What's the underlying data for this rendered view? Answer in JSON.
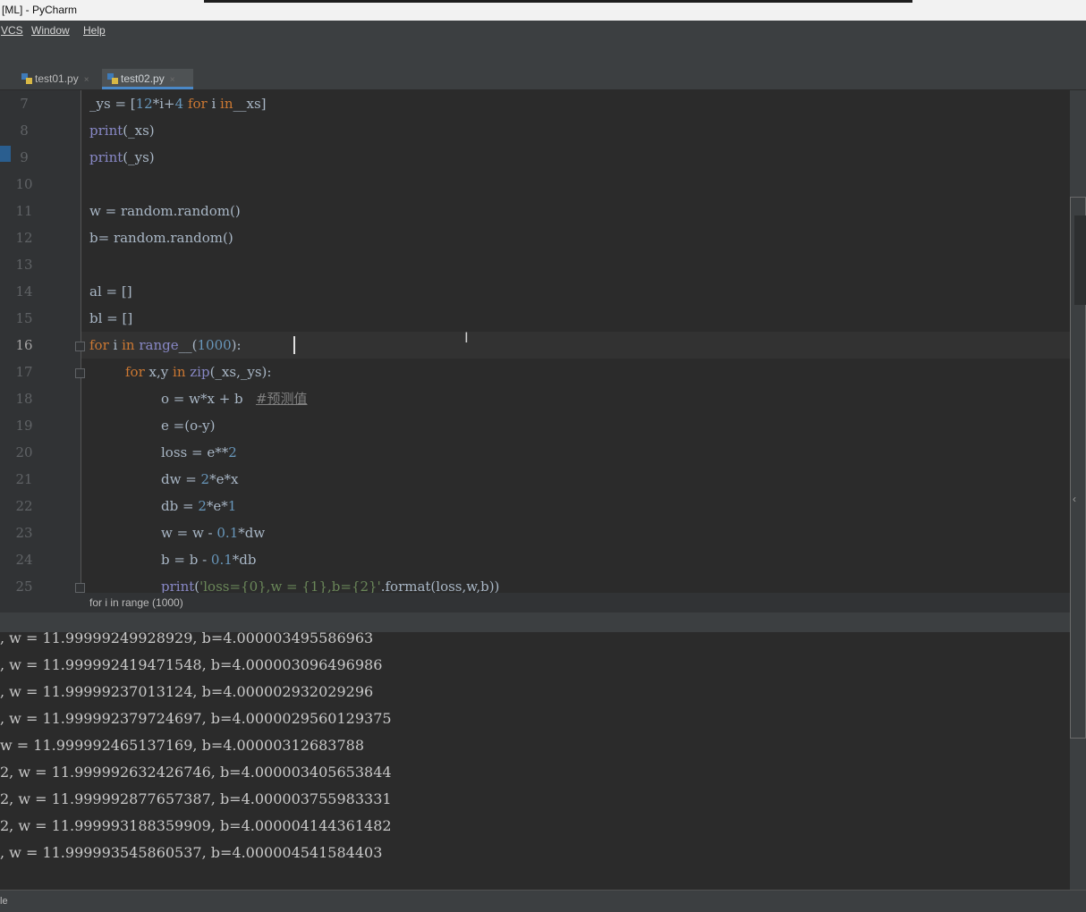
{
  "window": {
    "title": "[ML] - PyCharm"
  },
  "menu": {
    "vcs": "VCS",
    "window": "Window",
    "help": "Help"
  },
  "tabs": [
    {
      "label": "test01.py",
      "close": "×"
    },
    {
      "label": "test02.py",
      "close": "×"
    }
  ],
  "editor": {
    "line_numbers": [
      "7",
      "8",
      "9",
      "10",
      "11",
      "12",
      "13",
      "14",
      "15",
      "16",
      "17",
      "18",
      "19",
      "20",
      "21",
      "22",
      "23",
      "24",
      "25"
    ],
    "current_line": "16",
    "breadcrumb": "for i in range (1000)"
  },
  "console": {
    "lines": [
      ", w = 11.99999249928929, b=4.000003495586963",
      ", w = 11.999992419471548, b=4.000003096496986",
      ", w = 11.99999237013124, b=4.000002932029296",
      ", w = 11.999992379724697, b=4.0000029560129375",
      "w = 11.999992465137169, b=4.00000312683788",
      "2, w = 11.999992632426746, b=4.000003405653844",
      "2, w = 11.999992877657387, b=4.000003755983331",
      "2, w = 11.999993188359909, b=4.000004144361482",
      ", w = 11.999993545860537, b=4.000004541584403"
    ]
  },
  "statusbar": {
    "text": "le"
  },
  "colors": {
    "editor_bg": "#2b2b2b",
    "keyword": "#cc7832",
    "builtin": "#8888c6",
    "number": "#6897bb",
    "comment": "#808080",
    "string": "#6a8759",
    "active_tab_underline": "#4a88c7"
  },
  "icons": [
    "python-file-icon",
    "tab-close-icon",
    "fold-icon",
    "text-cursor-icon",
    "chevron-left-icon"
  ]
}
